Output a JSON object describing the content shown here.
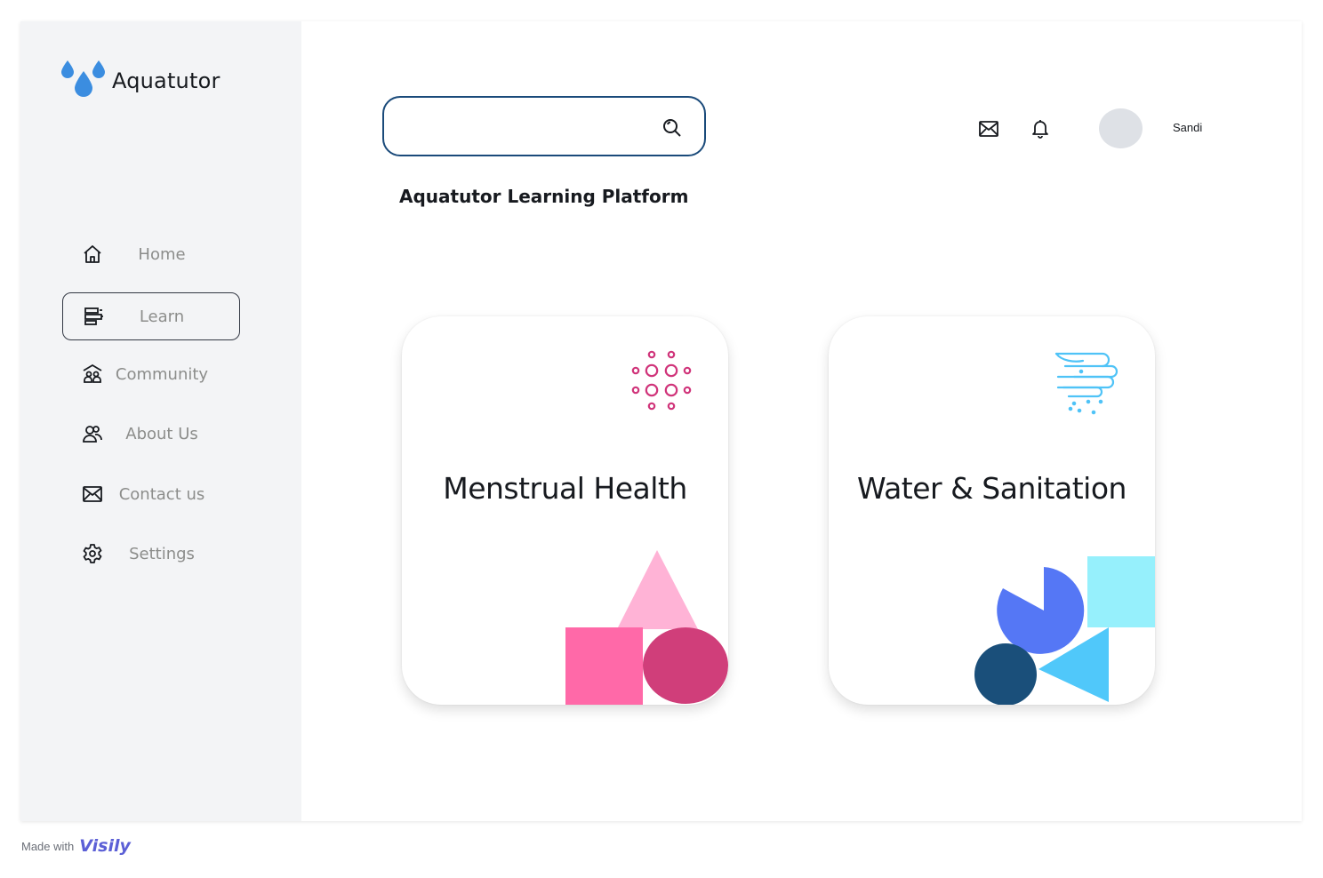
{
  "brand": {
    "name": "Aquatutor",
    "logo_icon": "water-drops-icon",
    "color": "#3b8de0"
  },
  "sidebar": {
    "items": [
      {
        "label": "Home",
        "icon": "home-icon",
        "active": false
      },
      {
        "label": "Learn",
        "icon": "learn-icon",
        "active": true
      },
      {
        "label": "Community",
        "icon": "community-icon",
        "active": false
      },
      {
        "label": "About Us",
        "icon": "about-us-icon",
        "active": false
      },
      {
        "label": "Contact us",
        "icon": "mail-icon",
        "active": false
      },
      {
        "label": "Settings",
        "icon": "gear-icon",
        "active": false
      }
    ]
  },
  "header": {
    "search": {
      "placeholder": "",
      "value": "",
      "icon": "search-icon"
    },
    "mail_icon": "mail-icon",
    "bell_icon": "bell-icon",
    "user": {
      "name": "Sandi",
      "avatar": "avatar"
    }
  },
  "main": {
    "title": "Aquatutor Learning Platform",
    "cards": [
      {
        "title": "Menstrual Health",
        "icon": "dots-circle-icon",
        "accent": "#d0347a"
      },
      {
        "title": "Water & Sanitation",
        "icon": "hand-water-icon",
        "accent": "#4fc3f7"
      }
    ]
  },
  "footer": {
    "made_with": "Made with",
    "brand": "Visily",
    "brand_color": "#5b5fd6"
  },
  "colors": {
    "sidebar_bg": "#f3f4f6",
    "search_border": "#1a4a7a",
    "pink_light": "#ffb3d6",
    "pink": "#ff69a8",
    "magenta": "#d03e7a",
    "blue_violet": "#5577f5",
    "cyan_light": "#96f0fc",
    "cyan": "#50c8fa",
    "navy": "#1a4f7a"
  }
}
